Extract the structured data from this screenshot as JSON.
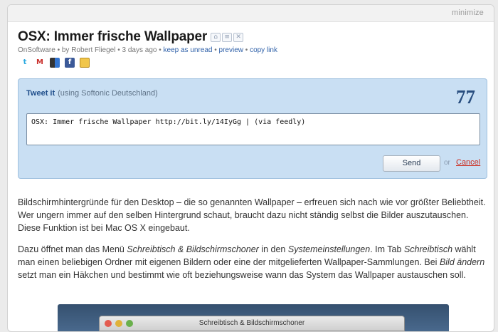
{
  "card": {
    "minimize_label": "minimize",
    "title": "OSX: Immer frische Wallpaper",
    "meta": {
      "source": "OnSoftware",
      "byline": " • by Robert Fliegel • 3 days ago • ",
      "keep_unread": "keep as unread",
      "preview": "preview",
      "copy_link": "copy link",
      "sep": " • "
    },
    "tool_icons": [
      "tag-icon",
      "note-icon",
      "close-icon"
    ],
    "share_icons": [
      "twitter-icon",
      "gmail-icon",
      "delicious-icon",
      "facebook-icon",
      "sticky-note-icon"
    ]
  },
  "tweet": {
    "label": "Tweet it",
    "account": "(using Softonic Deutschland)",
    "counter": "77",
    "text": "OSX: Immer frische Wallpaper http://bit.ly/14IyGg | (via feedly)",
    "send_label": "Send",
    "or_label": "or",
    "cancel_label": "Cancel"
  },
  "article": {
    "p1": "Bildschirmhintergründe für den Desktop – die so genannten Wallpaper – erfreuen sich nach wie vor größter Beliebtheit. Wer ungern immer auf den selben Hintergrund schaut, braucht dazu nicht ständig selbst die Bilder auszutauschen. Diese Funktion ist bei Mac OS X eingebaut.",
    "p2_a": "Dazu öffnet man das Menü ",
    "p2_b": "Schreibtisch & Bildschirmschoner",
    "p2_c": " in den ",
    "p2_d": "Systemeinstellungen",
    "p2_e": ". Im Tab ",
    "p2_f": "Schreibtisch",
    "p2_g": " wählt man einen beliebigen Ordner mit eigenen Bildern oder eine der mitgelieferten Wallpaper-Sammlungen. Bei ",
    "p2_h": "Bild ändern",
    "p2_i": " setzt man ein Häkchen und bestimmt wie oft beziehungsweise wann das System das Wallpaper austauschen soll.",
    "screenshot_window_title": "Schreibtisch & Bildschirmschoner"
  }
}
